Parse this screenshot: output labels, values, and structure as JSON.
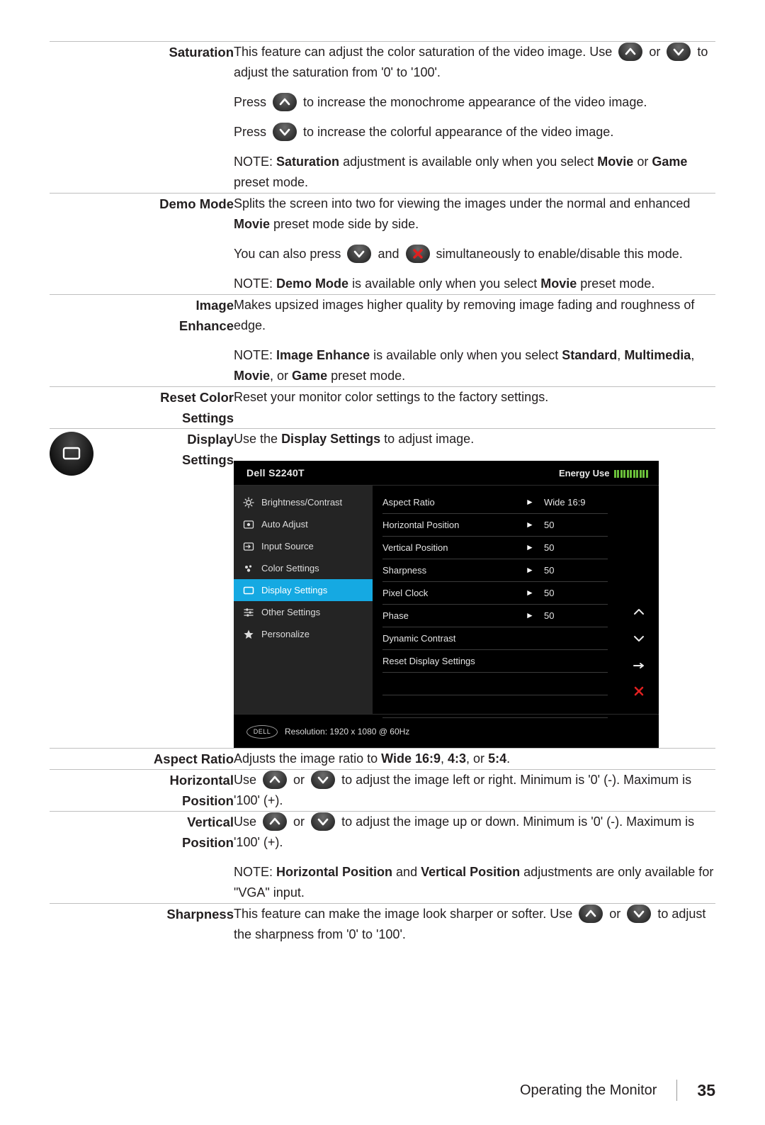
{
  "rows": [
    {
      "label": "Saturation",
      "paras": [
        "This feature can adjust the color saturation of the video image. Use",
        "or",
        "to adjust the saturation from '0' to '100'.",
        "Press",
        "to increase the monochrome appearance of the video image.",
        "Press",
        "to increase the colorful appearance of the video image."
      ],
      "note_prefix": "NOTE:",
      "note_bold1": "Saturation",
      "note_mid": "adjustment is available only when you select",
      "note_bold2": "Movie",
      "note_mid2": "or",
      "note_bold3": "Game",
      "note_end": "preset mode."
    },
    {
      "label": "Demo Mode",
      "p1a": "Splits the screen into two for viewing the images under the normal and enhanced",
      "p1b": "Movie",
      "p1c": "preset mode side by side.",
      "p2a": "You can also press",
      "p2b": "and",
      "p2c": "simultaneously to enable/disable this mode.",
      "note_prefix": "NOTE:",
      "note_bold1": "Demo Mode",
      "note_mid": "is available only when you select",
      "note_bold2": "Movie",
      "note_end": "preset mode."
    },
    {
      "label": "Image\nEnhance",
      "p1": "Makes upsized images higher quality by removing image fading and roughness of edge.",
      "note_prefix": "NOTE:",
      "note_bold1": "Image Enhance",
      "note_mid": "is available only when you select",
      "note_bold2": "Standard",
      "note_bold3": "Multimedia",
      "note_bold4": "Movie",
      "note_or": ", or",
      "note_bold5": "Game",
      "note_end": "preset mode."
    },
    {
      "label": "Reset Color\nSettings",
      "p1": "Reset your monitor color settings to the factory settings."
    }
  ],
  "display_settings": {
    "label": "Display\nSettings",
    "lead_a": "Use the",
    "lead_b": "Display Settings",
    "lead_c": "to adjust image."
  },
  "osd": {
    "model": "Dell S2240T",
    "energy_label": "Energy Use",
    "energy_bars": 11,
    "menu": [
      {
        "label": "Brightness/Contrast",
        "icon": "brightness-icon",
        "active": false
      },
      {
        "label": "Auto Adjust",
        "icon": "auto-adjust-icon",
        "active": false
      },
      {
        "label": "Input Source",
        "icon": "input-source-icon",
        "active": false
      },
      {
        "label": "Color Settings",
        "icon": "color-settings-icon",
        "active": false
      },
      {
        "label": "Display Settings",
        "icon": "display-settings-icon",
        "active": true
      },
      {
        "label": "Other Settings",
        "icon": "other-settings-icon",
        "active": false
      },
      {
        "label": "Personalize",
        "icon": "personalize-icon",
        "active": false
      }
    ],
    "options": [
      {
        "name": "Aspect Ratio",
        "value": "Wide 16:9",
        "arrow": true
      },
      {
        "name": "Horizontal Position",
        "value": "50",
        "arrow": true
      },
      {
        "name": "Vertical Position",
        "value": "50",
        "arrow": true
      },
      {
        "name": "Sharpness",
        "value": "50",
        "arrow": true
      },
      {
        "name": "Pixel Clock",
        "value": "50",
        "arrow": true
      },
      {
        "name": "Phase",
        "value": "50",
        "arrow": true
      },
      {
        "name": "Dynamic Contrast",
        "value": "",
        "arrow": false
      },
      {
        "name": "Reset Display Settings",
        "value": "",
        "arrow": false
      },
      {
        "name": "",
        "value": "",
        "arrow": false
      },
      {
        "name": "",
        "value": "",
        "arrow": false
      }
    ],
    "resolution": "Resolution: 1920 x 1080 @ 60Hz",
    "brand": "DELL",
    "accent_color": "#15a9e2",
    "energy_bar_color": "#6abf3a",
    "exit_color": "#e02020"
  },
  "rows2": [
    {
      "label": "Aspect Ratio",
      "p1a": "Adjusts the image ratio to",
      "p1b": "Wide 16:9",
      "p1c": ",",
      "p1d": "4:3",
      "p1e": ", or",
      "p1f": "5:4",
      "p1g": "."
    },
    {
      "label": "Horizontal\nPosition",
      "use": "Use",
      "or": "or",
      "tail": "to adjust the image left or right. Minimum is '0' (-). Maximum is '100' (+)."
    },
    {
      "label": "Vertical\nPosition",
      "use": "Use",
      "or": "or",
      "tail": "to adjust the image up or down. Minimum is '0' (-). Maximum is '100' (+).",
      "note_prefix": "NOTE:",
      "note_bold1": "Horizontal Position",
      "note_mid": "and",
      "note_bold2": "Vertical Position",
      "note_end": "adjustments are only available for \"VGA\" input."
    },
    {
      "label": "Sharpness",
      "p1a": "This feature can make the image look sharper or softer. Use",
      "p1b": "or",
      "p1c": "to adjust the sharpness from '0' to '100'."
    }
  ],
  "footer": {
    "title": "Operating the Monitor",
    "page": "35"
  }
}
